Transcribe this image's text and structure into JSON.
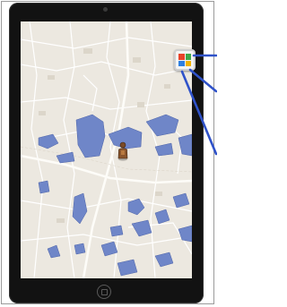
{
  "map": {
    "labels": [
      "",
      "",
      "",
      "",
      "",
      "",
      "",
      ""
    ],
    "pin": "person-marker-icon"
  },
  "menu_button": {
    "icon": "app-grid-icon",
    "colors": [
      "#e8432b",
      "#3fa84a",
      "#2f7fe0",
      "#f2b300"
    ]
  },
  "colors": {
    "map_background": "#ece8e0",
    "water_fill": "#6f86c8",
    "road_major": "#ffffff",
    "road_minor": "#f7f4ee",
    "callout_line": "#2f52c9",
    "device_bezel": "#121212"
  }
}
